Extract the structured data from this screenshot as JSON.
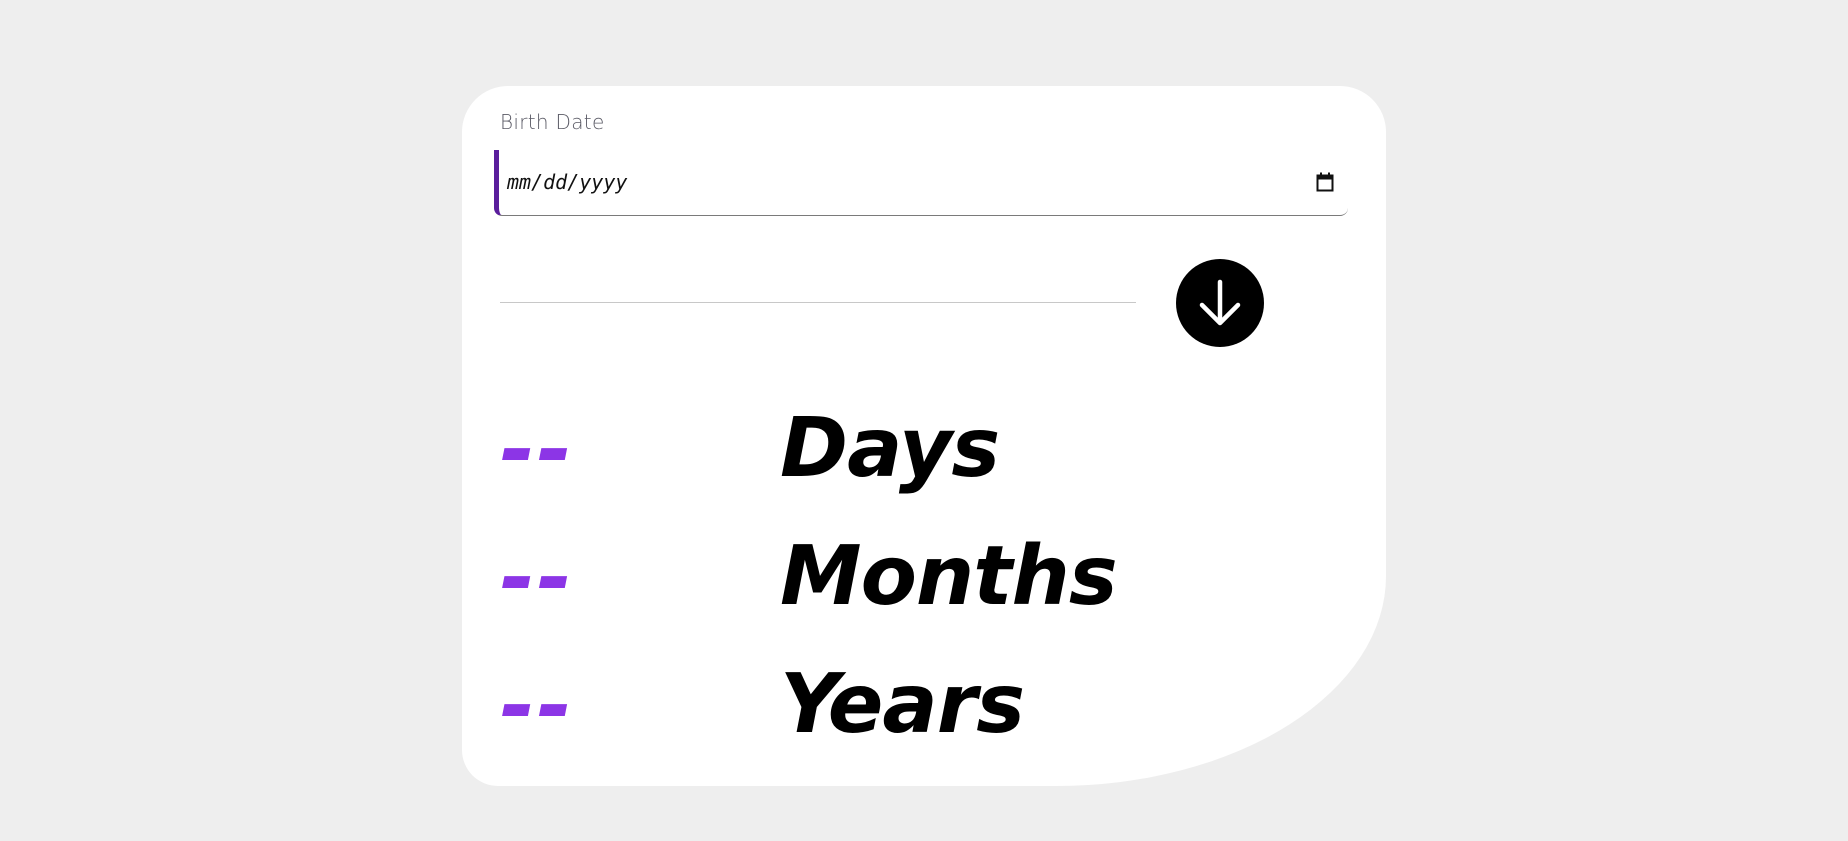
{
  "form": {
    "birth_date_label": "Birth Date",
    "birth_date_placeholder": "mm/dd/yyyy"
  },
  "icons": {
    "calendar": "calendar-icon",
    "submit": "arrow-down-icon"
  },
  "results": [
    {
      "value": "--",
      "unit": "Days"
    },
    {
      "value": "--",
      "unit": "Months"
    },
    {
      "value": "--",
      "unit": "Years"
    }
  ],
  "colors": {
    "accent": "#8c35e6",
    "input_border": "#5a1e9c",
    "button": "#000000",
    "background": "#eeeeee",
    "card": "#ffffff"
  }
}
